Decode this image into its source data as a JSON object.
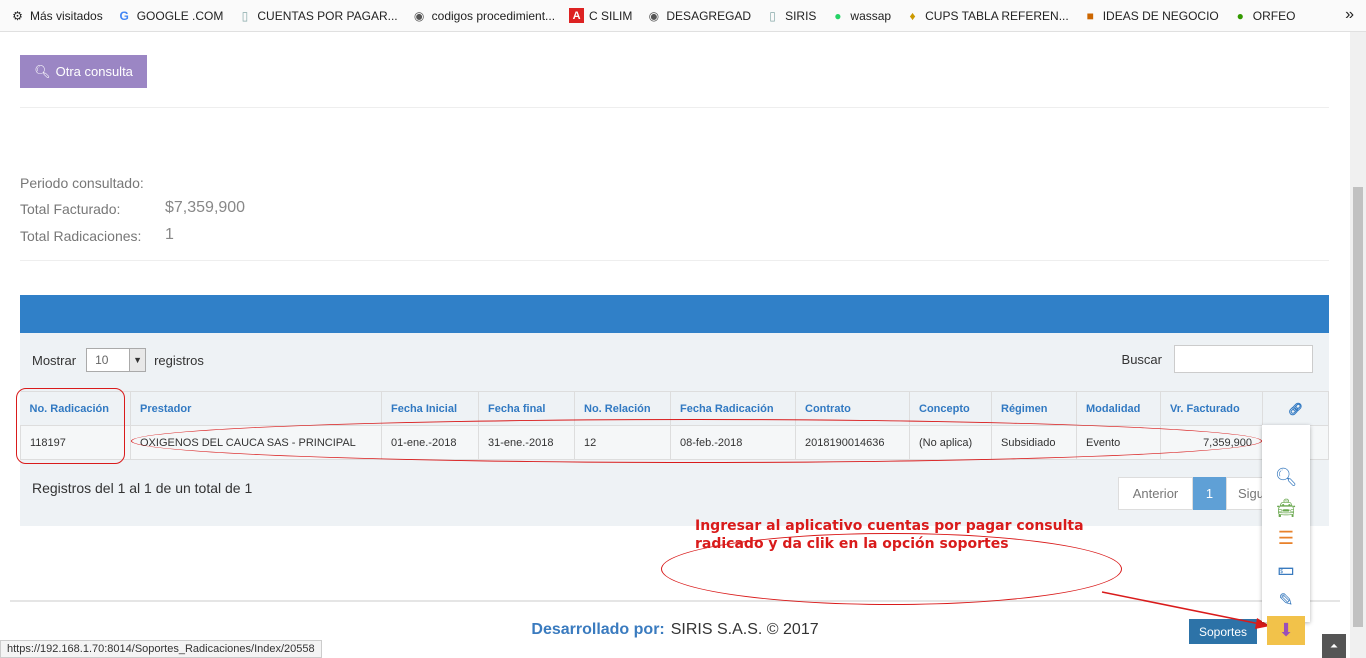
{
  "bookmarks": [
    {
      "label": "Más visitados",
      "icon": "gear-icon"
    },
    {
      "label": "GOOGLE .COM",
      "icon": "google-icon"
    },
    {
      "label": "CUENTAS POR PAGAR...",
      "icon": "page-icon"
    },
    {
      "label": "codigos procedimient...",
      "icon": "globe-icon"
    },
    {
      "label": "C SILIM",
      "icon": "red-a-icon"
    },
    {
      "label": "DESAGREGAD",
      "icon": "globe-icon"
    },
    {
      "label": "SIRIS",
      "icon": "page-icon"
    },
    {
      "label": "wassap",
      "icon": "whatsapp-icon"
    },
    {
      "label": "CUPS TABLA REFEREN...",
      "icon": "flag-icon"
    },
    {
      "label": "IDEAS DE NEGOCIO",
      "icon": "site-icon"
    },
    {
      "label": "ORFEO",
      "icon": "site-icon"
    }
  ],
  "otra_consulta": "Otra consulta",
  "summary": {
    "periodo_label": "Periodo consultado:",
    "facturado_label": "Total Facturado:",
    "facturado_value": "$7,359,900",
    "radicaciones_label": "Total Radicaciones:",
    "radicaciones_value": "1"
  },
  "table_controls": {
    "mostrar": "Mostrar",
    "page_size": "10",
    "registros": "registros",
    "buscar": "Buscar"
  },
  "table": {
    "headers": [
      "No. Radicación",
      "Prestador",
      "Fecha Inicial",
      "Fecha final",
      "No. Relación",
      "Fecha Radicación",
      "Contrato",
      "Concepto",
      "Régimen",
      "Modalidad",
      "Vr. Facturado"
    ],
    "row": [
      "118197",
      "OXIGENOS DEL CAUCA SAS - PRINCIPAL",
      "01-ene.-2018",
      "31-ene.-2018",
      "12",
      "08-feb.-2018",
      "2018190014636",
      "(No aplica)",
      "Subsidiado",
      "Evento",
      "7,359,900"
    ]
  },
  "pagination": {
    "info": "Registros del 1 al 1 de un total de 1",
    "prev": "Anterior",
    "current": "1",
    "next": "Sigu"
  },
  "callout": "Ingresar al aplicativo cuentas por pagar consulta radicado y da clik en la opción soportes",
  "footer": {
    "dev_label": "Desarrollado por:",
    "company": "SIRIS S.A.S. © 2017"
  },
  "tooltip": "Soportes",
  "status_url": "https://192.168.1.70:8014/Soportes_Radicaciones/Index/20558",
  "colors": {
    "blue_bar": "#3080c8",
    "purple_button": "#9b86c4",
    "annotation_red": "#d91b1b",
    "highlight_yellow": "#f2c24a"
  }
}
